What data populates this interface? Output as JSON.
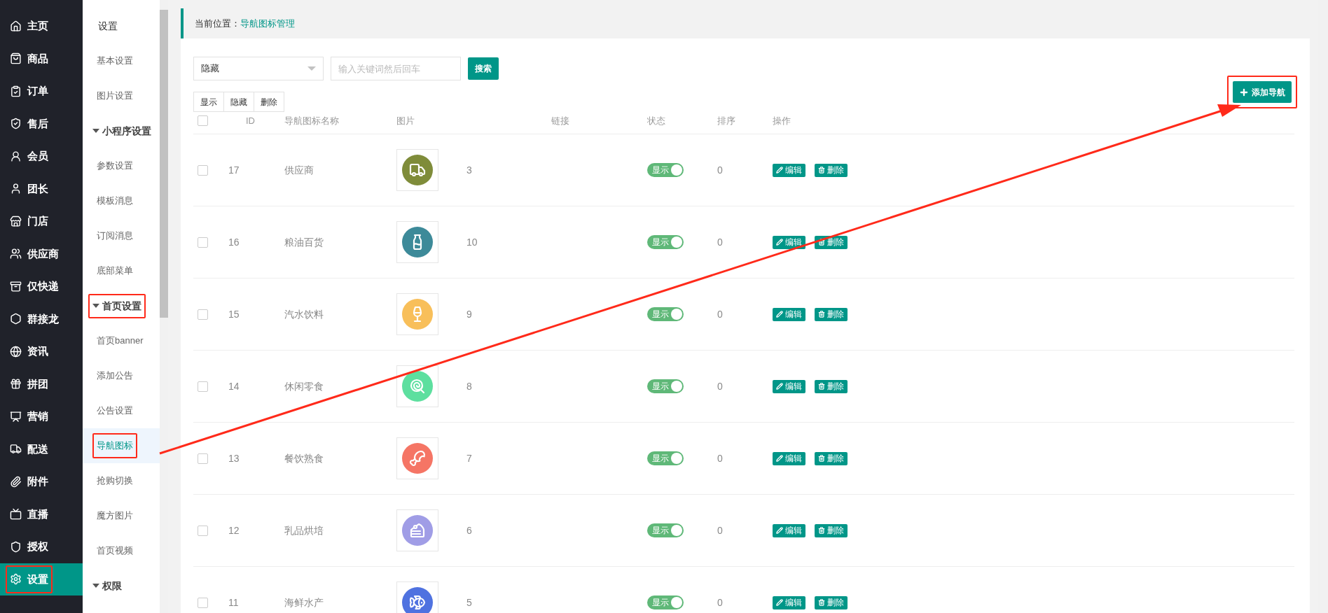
{
  "main_nav": [
    {
      "label": "主页",
      "selected": false,
      "highlighted": false
    },
    {
      "label": "商品",
      "selected": false,
      "highlighted": false
    },
    {
      "label": "订单",
      "selected": false,
      "highlighted": false
    },
    {
      "label": "售后",
      "selected": false,
      "highlighted": false
    },
    {
      "label": "会员",
      "selected": false,
      "highlighted": false
    },
    {
      "label": "团长",
      "selected": false,
      "highlighted": false
    },
    {
      "label": "门店",
      "selected": false,
      "highlighted": false
    },
    {
      "label": "供应商",
      "selected": false,
      "highlighted": false
    },
    {
      "label": "仅快递",
      "selected": false,
      "highlighted": false
    },
    {
      "label": "群接龙",
      "selected": false,
      "highlighted": false
    },
    {
      "label": "资讯",
      "selected": false,
      "highlighted": false
    },
    {
      "label": "拼团",
      "selected": false,
      "highlighted": false
    },
    {
      "label": "营销",
      "selected": false,
      "highlighted": false
    },
    {
      "label": "配送",
      "selected": false,
      "highlighted": false
    },
    {
      "label": "附件",
      "selected": false,
      "highlighted": false
    },
    {
      "label": "直播",
      "selected": false,
      "highlighted": false
    },
    {
      "label": "授权",
      "selected": false,
      "highlighted": false
    },
    {
      "label": "设置",
      "selected": true,
      "highlighted": true
    }
  ],
  "sub_nav": [
    {
      "kind": "title",
      "label": "设置"
    },
    {
      "kind": "item",
      "label": "基本设置",
      "selected": false,
      "highlighted": false
    },
    {
      "kind": "item",
      "label": "图片设置",
      "selected": false,
      "highlighted": false
    },
    {
      "kind": "group",
      "label": "小程序设置",
      "expanded": true,
      "highlighted": false
    },
    {
      "kind": "item",
      "label": "参数设置",
      "selected": false,
      "highlighted": false
    },
    {
      "kind": "item",
      "label": "模板消息",
      "selected": false,
      "highlighted": false
    },
    {
      "kind": "item",
      "label": "订阅消息",
      "selected": false,
      "highlighted": false
    },
    {
      "kind": "item",
      "label": "底部菜单",
      "selected": false,
      "highlighted": false
    },
    {
      "kind": "group",
      "label": "首页设置",
      "expanded": true,
      "highlighted": true
    },
    {
      "kind": "item",
      "label": "首页banner",
      "selected": false,
      "highlighted": false
    },
    {
      "kind": "item",
      "label": "添加公告",
      "selected": false,
      "highlighted": false
    },
    {
      "kind": "item",
      "label": "公告设置",
      "selected": false,
      "highlighted": false
    },
    {
      "kind": "item",
      "label": "导航图标",
      "selected": true,
      "highlighted": true
    },
    {
      "kind": "item",
      "label": "抢购切换",
      "selected": false,
      "highlighted": false
    },
    {
      "kind": "item",
      "label": "魔方图片",
      "selected": false,
      "highlighted": false
    },
    {
      "kind": "item",
      "label": "首页视频",
      "selected": false,
      "highlighted": false
    },
    {
      "kind": "group",
      "label": "权限",
      "expanded": true,
      "highlighted": false
    }
  ],
  "breadcrumb": {
    "label": "当前位置：",
    "current": "导航图标管理"
  },
  "filters": {
    "status_value": "隐藏",
    "search_placeholder": "输入关键词然后回车",
    "search_button": "搜索"
  },
  "bulk_actions": [
    "显示",
    "隐藏",
    "删除"
  ],
  "add_button": {
    "label": "添加导航",
    "highlighted": true
  },
  "annotation_arrow": true,
  "table": {
    "select_all_checked": false,
    "columns": [
      "ID",
      "导航图标名称",
      "图片",
      "链接",
      "状态",
      "排序",
      "操作"
    ],
    "rows": [
      {
        "checked": false,
        "id": "17",
        "name": "供应商",
        "color": "#7f8c3a",
        "link": "3",
        "status": {
          "label": "显示",
          "on": true
        },
        "sort": "0",
        "actions": [
          "编辑",
          "删除"
        ]
      },
      {
        "checked": false,
        "id": "16",
        "name": "粮油百货",
        "color": "#3d8a99",
        "link": "10",
        "status": {
          "label": "显示",
          "on": true
        },
        "sort": "0",
        "actions": [
          "编辑",
          "删除"
        ]
      },
      {
        "checked": false,
        "id": "15",
        "name": "汽水饮料",
        "color": "#f8bf5a",
        "link": "9",
        "status": {
          "label": "显示",
          "on": true
        },
        "sort": "0",
        "actions": [
          "编辑",
          "删除"
        ]
      },
      {
        "checked": false,
        "id": "14",
        "name": "休闲零食",
        "color": "#5ddf9f",
        "link": "8",
        "status": {
          "label": "显示",
          "on": true
        },
        "sort": "0",
        "actions": [
          "编辑",
          "删除"
        ]
      },
      {
        "checked": false,
        "id": "13",
        "name": "餐饮熟食",
        "color": "#f57565",
        "link": "7",
        "status": {
          "label": "显示",
          "on": true
        },
        "sort": "0",
        "actions": [
          "编辑",
          "删除"
        ]
      },
      {
        "checked": false,
        "id": "12",
        "name": "乳品烘培",
        "color": "#a09de6",
        "link": "6",
        "status": {
          "label": "显示",
          "on": true
        },
        "sort": "0",
        "actions": [
          "编辑",
          "删除"
        ]
      },
      {
        "checked": false,
        "id": "11",
        "name": "海鲜水产",
        "color": "#4f72e0",
        "link": "5",
        "status": {
          "label": "显示",
          "on": true
        },
        "sort": "0",
        "actions": [
          "编辑",
          "删除"
        ]
      }
    ]
  }
}
